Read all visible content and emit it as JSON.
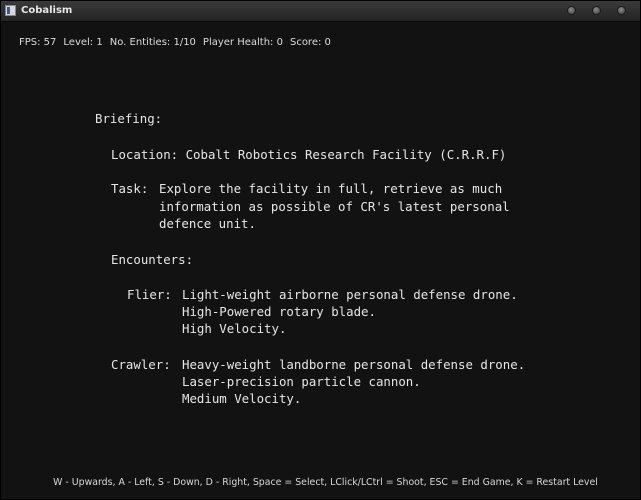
{
  "window": {
    "title": "Cobalism"
  },
  "hud": {
    "fps": "FPS: 57",
    "level": "Level: 1",
    "entities": "No. Entities: 1/10",
    "health": "Player Health: 0",
    "score": "Score: 0"
  },
  "briefing": {
    "heading": "Briefing:",
    "location": "Location: Cobalt Robotics Research Facility (C.R.R.F)",
    "task_label": "Task:",
    "task_lines": [
      "Explore the facility in full, retrieve as much",
      "information as possible of CR's latest personal",
      "defence unit."
    ],
    "encounters_heading": "Encounters:",
    "flier_label": "Flier:",
    "flier_lines": [
      "Light-weight airborne personal defense drone.",
      "High-Powered rotary blade.",
      "High Velocity."
    ],
    "crawler_label": "Crawler:",
    "crawler_lines": [
      "Heavy-weight landborne personal defense drone.",
      "Laser-precision particle cannon.",
      "Medium Velocity."
    ]
  },
  "controls": "W - Upwards, A - Left, S - Down, D - Right, Space = Select, LClick/LCtrl = Shoot, ESC = End Game, K = Restart Level"
}
